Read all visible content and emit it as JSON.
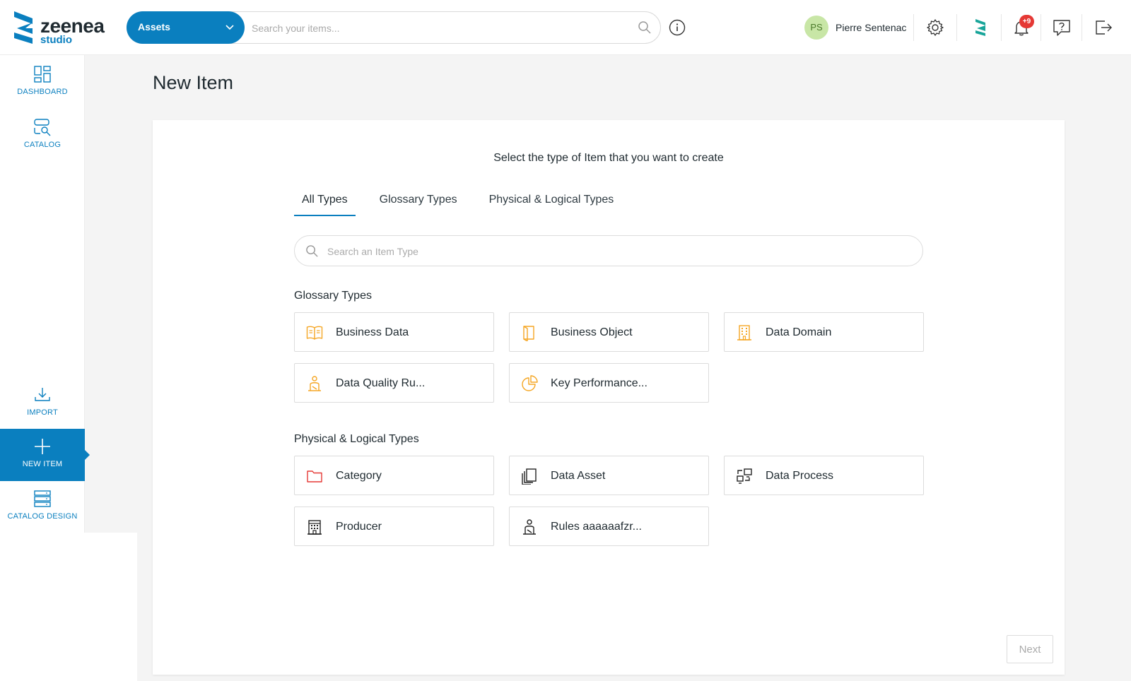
{
  "header": {
    "logo_primary": "zeenea",
    "logo_secondary": "studio",
    "scope_select": "Assets",
    "search_placeholder": "Search your items...",
    "user_initials": "PS",
    "user_name": "Pierre Sentenac",
    "notification_count": "+9"
  },
  "sidebar": {
    "items": [
      {
        "label": "DASHBOARD",
        "icon": "dashboard-icon"
      },
      {
        "label": "CATALOG",
        "icon": "catalog-icon"
      },
      {
        "label": "IMPORT",
        "icon": "import-icon"
      },
      {
        "label": "NEW ITEM",
        "icon": "plus-icon",
        "active": true
      },
      {
        "label": "CATALOG DESIGN",
        "icon": "catalog-design-icon"
      }
    ]
  },
  "main": {
    "title": "New Item",
    "subtitle": "Select the type of Item that you want to create",
    "tabs": [
      {
        "label": "All Types",
        "active": true
      },
      {
        "label": "Glossary Types"
      },
      {
        "label": "Physical & Logical Types"
      }
    ],
    "type_search_placeholder": "Search an Item Type",
    "glossary_section": {
      "title": "Glossary Types",
      "items": [
        {
          "label": "Business Data",
          "icon": "open-book-icon"
        },
        {
          "label": "Business Object",
          "icon": "book-icon"
        },
        {
          "label": "Data Domain",
          "icon": "building-icon"
        },
        {
          "label": "Data Quality Ru...",
          "icon": "judge-icon"
        },
        {
          "label": "Key Performance...",
          "icon": "pie-chart-icon"
        }
      ]
    },
    "physical_section": {
      "title": "Physical & Logical Types",
      "items": [
        {
          "label": "Category",
          "icon": "folder-icon"
        },
        {
          "label": "Data Asset",
          "icon": "files-icon"
        },
        {
          "label": "Data Process",
          "icon": "process-icon"
        },
        {
          "label": "Producer",
          "icon": "office-building-icon"
        },
        {
          "label": "Rules aaaaaafzr...",
          "icon": "judge-icon"
        }
      ]
    },
    "next_label": "Next"
  },
  "colors": {
    "accent": "#0a7fbf",
    "glossary_icon": "#f5a623",
    "category_icon": "#e53935",
    "badge": "#e53935",
    "avatar_bg": "#c8e6a6"
  }
}
